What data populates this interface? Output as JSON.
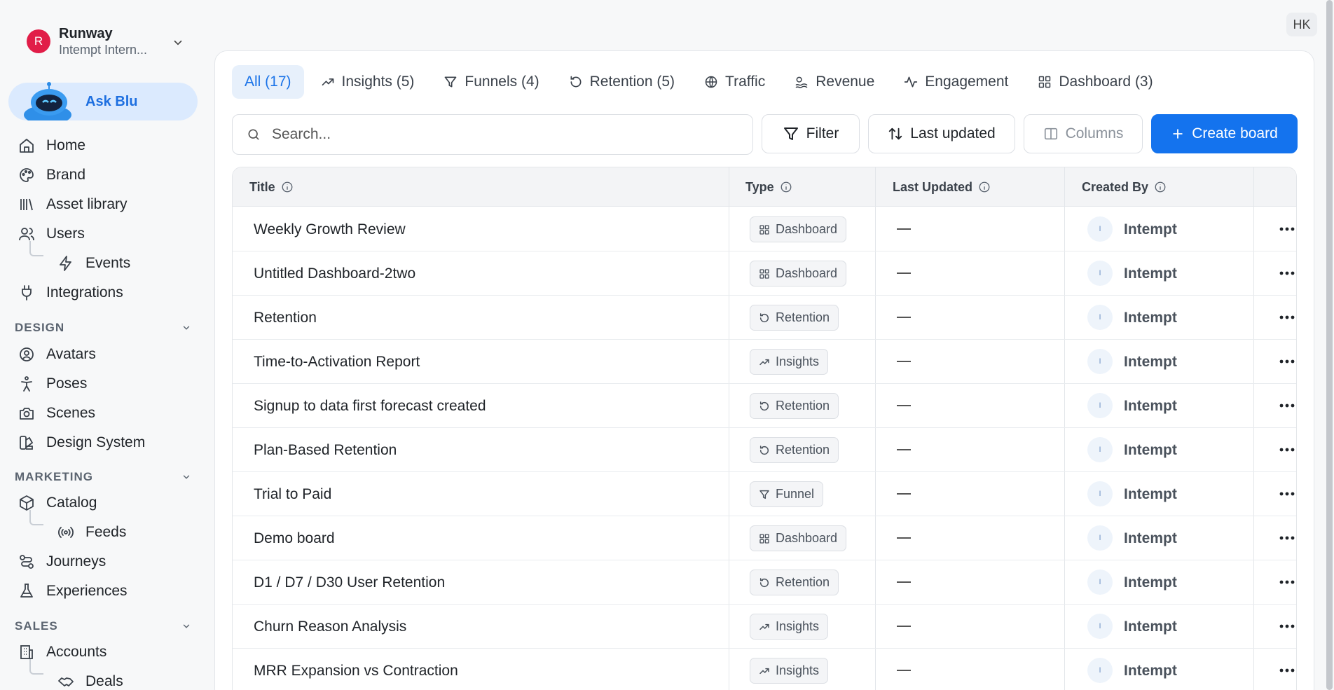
{
  "workspace": {
    "initial": "R",
    "name": "Runway",
    "subtitle": "Intempt Intern..."
  },
  "ask_blu": {
    "label": "Ask Blu"
  },
  "sidebar": {
    "main": [
      {
        "label": "Home",
        "icon": "home-icon"
      },
      {
        "label": "Brand",
        "icon": "palette-icon"
      },
      {
        "label": "Asset library",
        "icon": "library-icon"
      },
      {
        "label": "Users",
        "icon": "users-icon"
      },
      {
        "label": "Events",
        "icon": "zap-icon"
      },
      {
        "label": "Integrations",
        "icon": "plug-icon"
      }
    ],
    "design_title": "DESIGN",
    "design": [
      {
        "label": "Avatars",
        "icon": "user-circle-icon"
      },
      {
        "label": "Poses",
        "icon": "person-icon"
      },
      {
        "label": "Scenes",
        "icon": "camera-icon"
      },
      {
        "label": "Design System",
        "icon": "swatch-icon"
      }
    ],
    "marketing_title": "MARKETING",
    "marketing": [
      {
        "label": "Catalog",
        "icon": "box-icon"
      },
      {
        "label": "Feeds",
        "icon": "radio-icon"
      },
      {
        "label": "Journeys",
        "icon": "route-icon"
      },
      {
        "label": "Experiences",
        "icon": "flask-icon"
      }
    ],
    "sales_title": "SALES",
    "sales": [
      {
        "label": "Accounts",
        "icon": "building-icon"
      },
      {
        "label": "Deals",
        "icon": "handshake-icon"
      }
    ]
  },
  "user_initials": "HK",
  "tabs": [
    {
      "label": "All (17)",
      "icon": ""
    },
    {
      "label": "Insights (5)",
      "icon": "trending-icon"
    },
    {
      "label": "Funnels (4)",
      "icon": "funnel-icon"
    },
    {
      "label": "Retention (5)",
      "icon": "retention-icon"
    },
    {
      "label": "Traffic",
      "icon": "globe-icon"
    },
    {
      "label": "Revenue",
      "icon": "revenue-icon"
    },
    {
      "label": "Engagement",
      "icon": "activity-icon"
    },
    {
      "label": "Dashboard (3)",
      "icon": "dashboard-icon"
    }
  ],
  "toolbar": {
    "search_placeholder": "Search...",
    "filter_label": "Filter",
    "sort_label": "Last updated",
    "columns_label": "Columns",
    "create_label": "Create board"
  },
  "table": {
    "headers": {
      "title": "Title",
      "type": "Type",
      "last_updated": "Last Updated",
      "created_by": "Created By"
    },
    "rows": [
      {
        "title": "Weekly Growth Review",
        "type": "Dashboard",
        "updated": "—",
        "avatar": "I",
        "creator": "Intempt"
      },
      {
        "title": "Untitled Dashboard-2two",
        "type": "Dashboard",
        "updated": "—",
        "avatar": "I",
        "creator": "Intempt"
      },
      {
        "title": "Retention",
        "type": "Retention",
        "updated": "—",
        "avatar": "I",
        "creator": "Intempt"
      },
      {
        "title": "Time-to-Activation Report",
        "type": "Insights",
        "updated": "—",
        "avatar": "I",
        "creator": "Intempt"
      },
      {
        "title": "Signup to data first forecast created",
        "type": "Retention",
        "updated": "—",
        "avatar": "I",
        "creator": "Intempt"
      },
      {
        "title": "Plan-Based Retention",
        "type": "Retention",
        "updated": "—",
        "avatar": "I",
        "creator": "Intempt"
      },
      {
        "title": "Trial to Paid",
        "type": "Funnel",
        "updated": "—",
        "avatar": "I",
        "creator": "Intempt"
      },
      {
        "title": "Demo board",
        "type": "Dashboard",
        "updated": "—",
        "avatar": "I",
        "creator": "Intempt"
      },
      {
        "title": "D1 / D7 / D30 User Retention",
        "type": "Retention",
        "updated": "—",
        "avatar": "I",
        "creator": "Intempt"
      },
      {
        "title": "Churn Reason Analysis",
        "type": "Insights",
        "updated": "—",
        "avatar": "I",
        "creator": "Intempt"
      },
      {
        "title": "MRR Expansion vs Contraction",
        "type": "Insights",
        "updated": "—",
        "avatar": "I",
        "creator": "Intempt"
      }
    ]
  },
  "colors": {
    "accent": "#1473ee",
    "tab_active_bg": "#e7f0fb",
    "brand_badge": "#e11d48"
  }
}
